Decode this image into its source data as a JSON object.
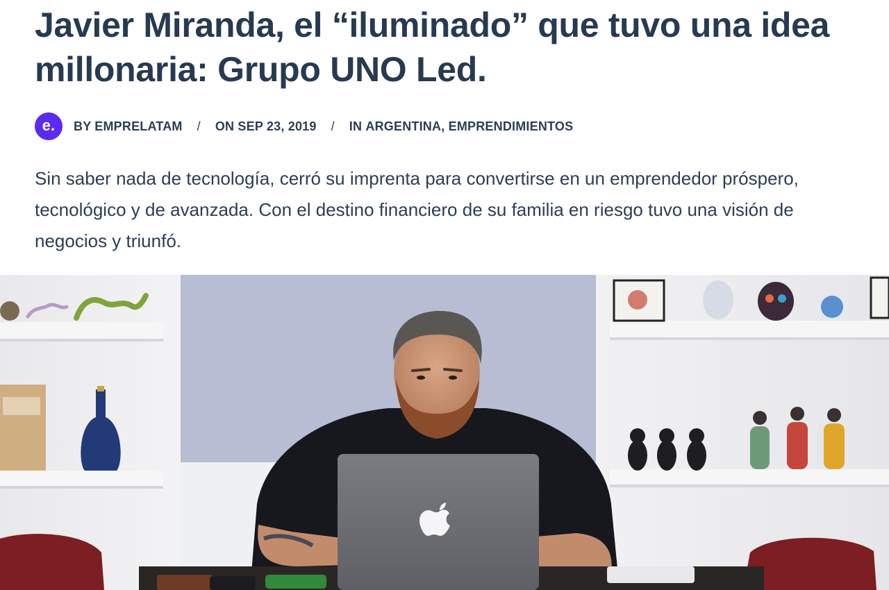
{
  "article": {
    "title": "Javier Miranda, el “iluminado” que tuvo una idea millonaria: Grupo UNO Led.",
    "meta": {
      "avatar_letter": "e.",
      "author_label": "BY EMPRELATAM",
      "separator": "/",
      "date_label": "ON SEP 23, 2019",
      "category_prefix": "IN",
      "categories": [
        "ARGENTINA",
        "EMPRENDIMIENTOS"
      ],
      "category_delimiter": ","
    },
    "excerpt": "Sin saber nada de tecnología, cerró su imprenta para convertirse en un emprendedor próspero, tecnológico y de avanzada. Con el destino financiero de su familia en riesgo tuvo una visión de negocios y triunfó."
  },
  "colors": {
    "text": "#2c3e55",
    "title": "#273a52",
    "avatar_bg": "#5b2bf0"
  },
  "icons": {
    "avatar": "emprelatam-logo-icon",
    "laptop_logo": "apple-logo-icon"
  }
}
